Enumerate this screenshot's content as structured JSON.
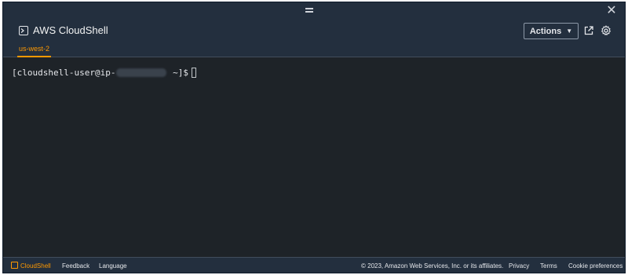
{
  "window": {
    "title": "AWS CloudShell",
    "close_symbol": "✕"
  },
  "header": {
    "actions_label": "Actions",
    "actions_caret": "▼"
  },
  "tabs": [
    {
      "label": "us-west-2",
      "active": true
    }
  ],
  "terminal": {
    "prompt_prefix": "[cloudshell-user@ip-",
    "prompt_suffix": " ~]$"
  },
  "footer": {
    "cloudshell_label": "CloudShell",
    "feedback_label": "Feedback",
    "language_label": "Language",
    "copyright": "© 2023, Amazon Web Services, Inc. or its affiliates.",
    "privacy_label": "Privacy",
    "terms_label": "Terms",
    "cookie_label": "Cookie preferences"
  },
  "colors": {
    "accent": "#ff9900",
    "chrome_bg": "#232f3e",
    "terminal_bg": "#1e2328"
  },
  "icons": [
    "terminal-icon",
    "drag-handle-icon",
    "close-icon",
    "caret-down-icon",
    "external-link-icon",
    "gear-icon",
    "cloudshell-icon"
  ]
}
